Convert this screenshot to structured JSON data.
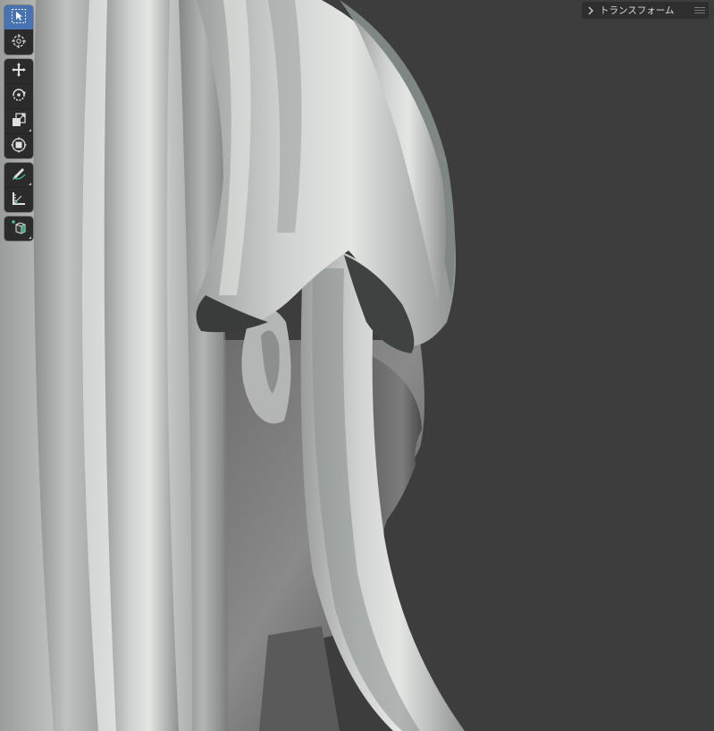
{
  "toolbar": {
    "groups": [
      [
        {
          "name": "select-box-tool",
          "icon": "select-box-icon",
          "active": true
        },
        {
          "name": "cursor-tool",
          "icon": "cursor-icon"
        }
      ],
      [
        {
          "name": "move-tool",
          "icon": "move-icon"
        },
        {
          "name": "rotate-tool",
          "icon": "rotate-icon"
        },
        {
          "name": "scale-tool",
          "icon": "scale-icon"
        },
        {
          "name": "transform-tool",
          "icon": "transform-icon"
        }
      ],
      [
        {
          "name": "annotate-tool",
          "icon": "annotate-icon"
        },
        {
          "name": "measure-tool",
          "icon": "measure-icon"
        }
      ],
      [
        {
          "name": "add-cube-tool",
          "icon": "add-cube-icon"
        }
      ]
    ],
    "active_color": "#4772b3"
  },
  "sidebar": {
    "transform_label": "トランスフォーム"
  },
  "viewport": {
    "background_color": "#3d3d3d",
    "subject": "hair-sculpt-model"
  }
}
